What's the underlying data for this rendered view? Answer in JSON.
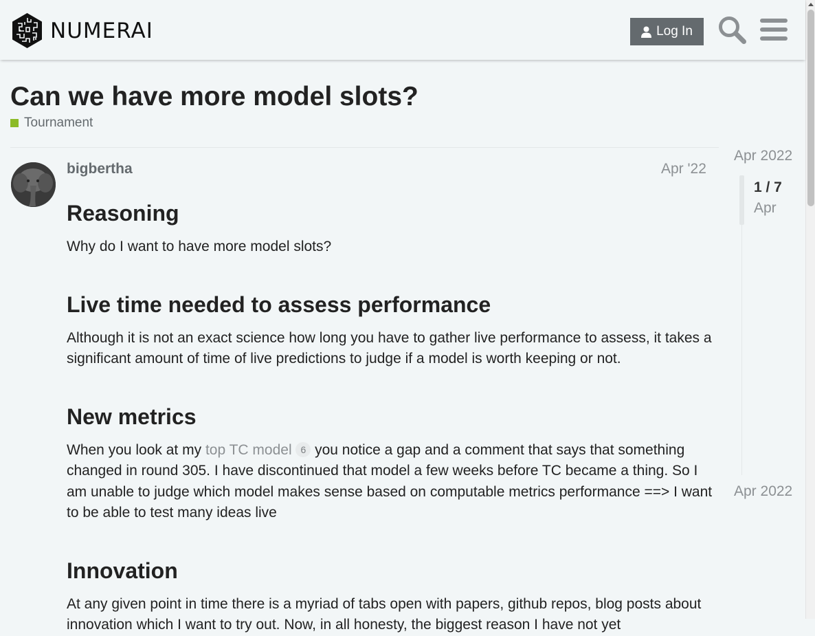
{
  "header": {
    "brand": "NUMERAI",
    "login_label": "Log In"
  },
  "topic": {
    "title": "Can we have more model slots?",
    "category": "Tournament",
    "category_color": "#8cbb28"
  },
  "post": {
    "username": "bigbertha",
    "date": "Apr '22",
    "sections": [
      {
        "heading": "Reasoning",
        "text": "Why do I want to have more model slots?"
      },
      {
        "heading": "Live time needed to assess performance",
        "text": "Although it is not an exact science how long you have to gather live performance to assess, it takes a significant amount of time of live predictions to judge if a model is worth keeping or not."
      },
      {
        "heading": "New metrics",
        "text_before": "When you look at my",
        "link": "top TC model",
        "link_clicks": "6",
        "text_after": "you notice a gap and a comment that says that something changed in round 305. I have discontinued that model a few weeks before TC became a thing. So I am unable to judge which model makes sense based on computable metrics performance ==> I want to be able to test many ideas live"
      },
      {
        "heading": "Innovation",
        "text": "At any given point in time there is a myriad of tabs open with papers, github repos, blog posts about innovation which I want to try out. Now, in all honesty, the biggest reason I have not yet"
      }
    ]
  },
  "timeline": {
    "start_date": "Apr 2022",
    "position": "1 / 7",
    "current_month": "Apr",
    "end_date": "Apr 2022"
  },
  "colors": {
    "accent_button": "#646a6e",
    "background": "#f2f6f7",
    "link": "#8c9093"
  }
}
